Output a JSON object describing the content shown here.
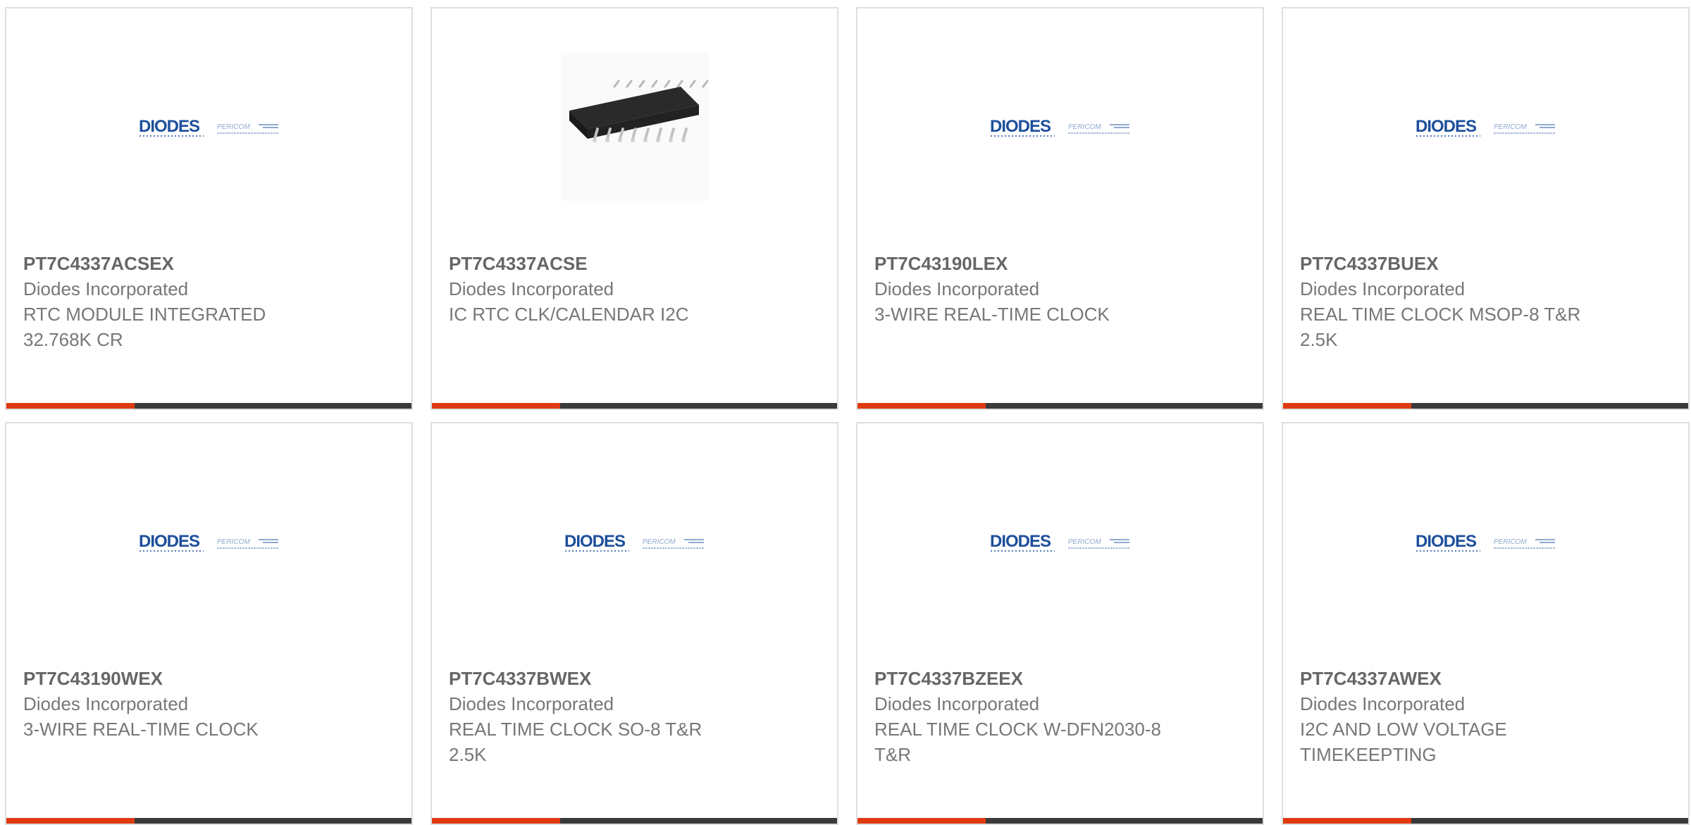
{
  "colors": {
    "accent": "#e03a10",
    "bar_dark": "#3a3a3a",
    "logo_blue": "#1d4f9c",
    "logo_light": "#8fa9cf"
  },
  "logo": {
    "brand": "DIODES",
    "sub": "PERICOM"
  },
  "products": [
    {
      "part_number": "PT7C4337ACSEX",
      "manufacturer": "Diodes Incorporated",
      "description": "RTC MODULE INTEGRATED 32.768K CR",
      "image": "diodes-pericom-logo"
    },
    {
      "part_number": "PT7C4337ACSE",
      "manufacturer": "Diodes Incorporated",
      "description": "IC RTC CLK/CALENDAR I2C",
      "image": "soic-chip"
    },
    {
      "part_number": "PT7C43190LEX",
      "manufacturer": "Diodes Incorporated",
      "description": "3-WIRE REAL-TIME CLOCK",
      "image": "diodes-pericom-logo"
    },
    {
      "part_number": "PT7C4337BUEX",
      "manufacturer": "Diodes Incorporated",
      "description": "REAL TIME CLOCK MSOP-8 T&R 2.5K",
      "image": "diodes-pericom-logo"
    },
    {
      "part_number": "PT7C43190WEX",
      "manufacturer": "Diodes Incorporated",
      "description": "3-WIRE REAL-TIME CLOCK",
      "image": "diodes-pericom-logo"
    },
    {
      "part_number": "PT7C4337BWEX",
      "manufacturer": "Diodes Incorporated",
      "description": "REAL TIME CLOCK SO-8 T&R 2.5K",
      "image": "diodes-pericom-logo"
    },
    {
      "part_number": "PT7C4337BZEEX",
      "manufacturer": "Diodes Incorporated",
      "description": "REAL TIME CLOCK W-DFN2030-8 T&R",
      "image": "diodes-pericom-logo"
    },
    {
      "part_number": "PT7C4337AWEX",
      "manufacturer": "Diodes Incorporated",
      "description": "I2C AND LOW VOLTAGE TIMEKEEPTING",
      "image": "diodes-pericom-logo"
    }
  ]
}
